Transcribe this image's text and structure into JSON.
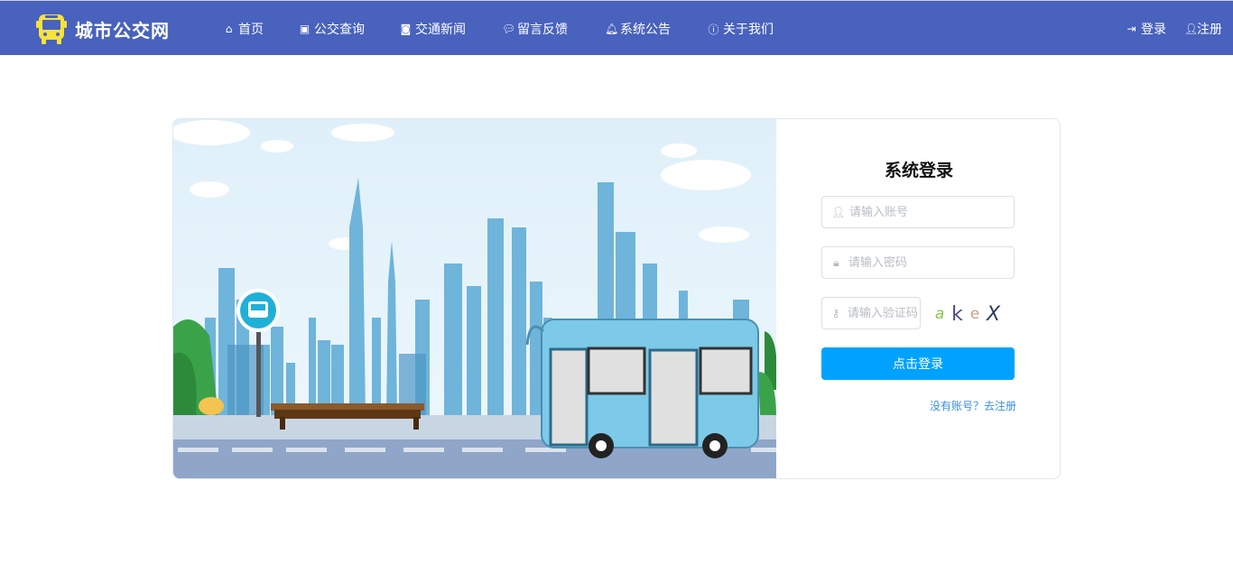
{
  "nav": {
    "brand": "城市公交网",
    "items": [
      {
        "label": "首页",
        "icon": "home-icon"
      },
      {
        "label": "公交查询",
        "icon": "bus-icon"
      },
      {
        "label": "交通新闻",
        "icon": "instagram-icon"
      },
      {
        "label": "留言反馈",
        "icon": "comment-icon"
      },
      {
        "label": "系统公告",
        "icon": "bell-icon"
      },
      {
        "label": "关于我们",
        "icon": "info-icon"
      }
    ],
    "login": "登录",
    "register": "注册"
  },
  "form": {
    "title": "系统登录",
    "account_placeholder": "请输入账号",
    "password_placeholder": "请输入密码",
    "captcha_placeholder": "请输入验证码",
    "captcha_chars": [
      "a",
      "k",
      "e",
      "X"
    ],
    "captcha_colors": [
      "#8bc34a",
      "#4a4a8a",
      "#c9a08a",
      "#2c3e5a"
    ],
    "submit": "点击登录",
    "register_link": "没有账号？去注册"
  },
  "colors": {
    "nav": "#4862bd",
    "button": "#00a2ff",
    "link": "#3a8ee6"
  }
}
